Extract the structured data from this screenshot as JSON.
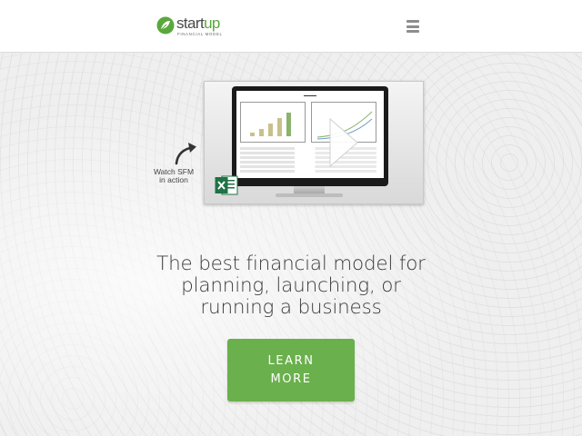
{
  "header": {
    "logo": {
      "word_main": "start",
      "word_accent": "up",
      "tagline": "FINANCIAL MODEL"
    },
    "menu_icon": "hamburger-menu-icon"
  },
  "video": {
    "caption_line1": "Watch SFM",
    "caption_line2": "in action",
    "play_icon": "play-icon",
    "excel_icon": "excel-icon"
  },
  "hero": {
    "headline_line1": "The best financial model for",
    "headline_line2": "planning, launching, or",
    "headline_line3": "running a business"
  },
  "cta": {
    "line1": "LEARN",
    "line2": "MORE"
  },
  "colors": {
    "brand_green": "#6ab04c",
    "logo_gray": "#4a4a4a",
    "header_bg": "#ffffff"
  }
}
